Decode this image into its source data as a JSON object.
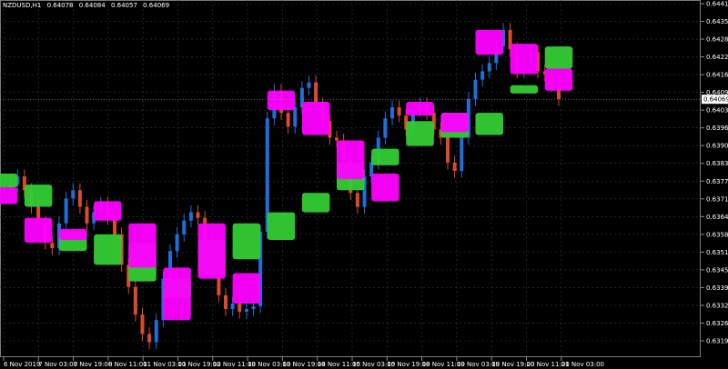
{
  "header": {
    "symbol": "NZDUSD,H1",
    "open": "0.64078",
    "high": "0.64084",
    "low": "0.64057",
    "close": "0.64069"
  },
  "chart_data": {
    "type": "candlestick",
    "title": "NZDUSD,H1",
    "background": "#000000",
    "grid": true,
    "grid_color": "#2a3a4a",
    "colors": {
      "bull_band": "#33cc33",
      "bear_band": "#ff00ff",
      "candle": "#1e6fd9",
      "candle_down": "#d94b2a",
      "axis_text": "#ffffff"
    },
    "ylim": [
      0.63195,
      0.64415
    ],
    "y_ticks": [
      "0.64415",
      "0.64350",
      "0.64285",
      "0.64220",
      "0.64160",
      "0.64095",
      "0.64030",
      "0.63965",
      "0.63900",
      "0.63835",
      "0.63775",
      "0.63710",
      "0.63645",
      "0.63580",
      "0.63515",
      "0.63450",
      "0.63390",
      "0.63325",
      "0.63260",
      "0.63195"
    ],
    "current_price": "0.64069",
    "x_labels": [
      "6 Nov 2019",
      "7 Nov 03:00",
      "7 Nov 19:00",
      "8 Nov 11:00",
      "11 Nov 03:00",
      "11 Nov 19:00",
      "12 Nov 11:00",
      "13 Nov 03:00",
      "13 Nov 19:00",
      "14 Nov 11:00",
      "15 Nov 03:00",
      "15 Nov 19:00",
      "18 Nov 11:00",
      "19 Nov 03:00",
      "19 Nov 19:00",
      "20 Nov 11:00",
      "21 Nov 03:00"
    ],
    "close_series": [
      0.6375,
      0.6376,
      0.6379,
      0.6374,
      0.6368,
      0.6362,
      0.6355,
      0.6353,
      0.6362,
      0.6371,
      0.6374,
      0.6368,
      0.6362,
      0.6366,
      0.6369,
      0.6364,
      0.6358,
      0.6347,
      0.6339,
      0.6329,
      0.6322,
      0.6319,
      0.6327,
      0.6342,
      0.6352,
      0.6358,
      0.6363,
      0.6366,
      0.6364,
      0.6356,
      0.6345,
      0.6336,
      0.6331,
      0.6333,
      0.633,
      0.6331,
      0.6332,
      0.6359,
      0.64,
      0.641,
      0.6402,
      0.6397,
      0.6404,
      0.6411,
      0.6413,
      0.6405,
      0.6399,
      0.6393,
      0.6392,
      0.6385,
      0.6373,
      0.6368,
      0.6379,
      0.6384,
      0.6393,
      0.64,
      0.6404,
      0.6401,
      0.6396,
      0.6403,
      0.6405,
      0.6402,
      0.6396,
      0.6393,
      0.6384,
      0.6381,
      0.6393,
      0.6407,
      0.6414,
      0.6417,
      0.642,
      0.6426,
      0.6432,
      0.6425,
      0.6417,
      0.642,
      0.6424,
      0.6417,
      0.6416,
      0.6412,
      0.6407
    ],
    "bull_band_series": [
      [
        0.6375,
        0.638
      ],
      [
        0.6368,
        0.6376
      ],
      [
        0.6352,
        0.6359
      ],
      [
        0.6347,
        0.6358
      ],
      [
        0.6341,
        0.6355
      ],
      [
        0.6335,
        0.6342
      ],
      [
        0.6343,
        0.6356
      ],
      [
        0.6349,
        0.6362
      ],
      [
        0.6356,
        0.6366
      ],
      [
        0.6366,
        0.6373
      ],
      [
        0.6374,
        0.6384
      ],
      [
        0.6383,
        0.6389
      ],
      [
        0.639,
        0.6399
      ],
      [
        0.6393,
        0.6402
      ],
      [
        0.6394,
        0.6402
      ],
      [
        0.6409,
        0.6412
      ],
      [
        0.6418,
        0.6426
      ]
    ],
    "bear_band_series": [
      [
        0.6369,
        0.6375
      ],
      [
        0.6355,
        0.6364
      ],
      [
        0.6356,
        0.636
      ],
      [
        0.6363,
        0.637
      ],
      [
        0.6346,
        0.6362
      ],
      [
        0.6327,
        0.6346
      ],
      [
        0.6342,
        0.6362
      ],
      [
        0.6333,
        0.6344
      ],
      [
        0.6403,
        0.641
      ],
      [
        0.6394,
        0.6406
      ],
      [
        0.6378,
        0.6392
      ],
      [
        0.637,
        0.638
      ],
      [
        0.6401,
        0.6406
      ],
      [
        0.6395,
        0.6402
      ],
      [
        0.6423,
        0.6432
      ],
      [
        0.6416,
        0.6427
      ],
      [
        0.641,
        0.6418
      ]
    ]
  }
}
